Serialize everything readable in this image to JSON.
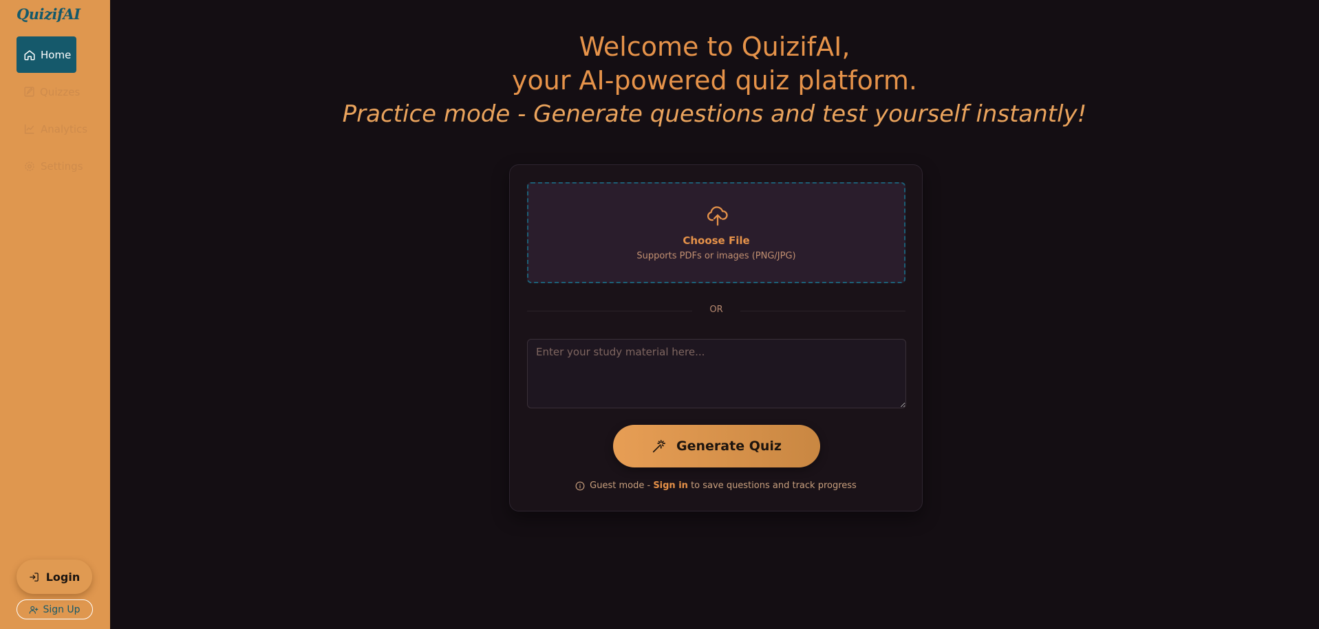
{
  "app": {
    "logo": "QuizifAI"
  },
  "sidebar": {
    "items": [
      {
        "label": "Home",
        "icon": "home-icon",
        "active": true
      },
      {
        "label": "Quizzes",
        "icon": "pencil-icon",
        "active": false
      },
      {
        "label": "Analytics",
        "icon": "chart-icon",
        "active": false
      },
      {
        "label": "Settings",
        "icon": "gear-icon",
        "active": false
      }
    ],
    "login_label": "Login",
    "signup_label": "Sign Up"
  },
  "hero": {
    "line1": "Welcome to QuizifAI,",
    "line2": "your AI-powered quiz platform.",
    "line3": "Practice mode - Generate questions and test yourself instantly!"
  },
  "upload": {
    "icon": "cloud-upload-icon",
    "choose_label": "Choose File",
    "supports_label": "Supports PDFs or images (PNG/JPG)"
  },
  "divider_label": "OR",
  "study_input": {
    "placeholder": "Enter your study material here...",
    "value": ""
  },
  "generate": {
    "label": "Generate Quiz",
    "icon": "magic-wand-icon"
  },
  "guest": {
    "prefix": "Guest mode - ",
    "link": "Sign in",
    "suffix": " to save questions and track progress",
    "icon": "info-icon"
  },
  "colors": {
    "sidebar_bg": "#df974f",
    "accent": "#e6934a",
    "teal": "#15596b",
    "page_bg": "#140e13"
  }
}
